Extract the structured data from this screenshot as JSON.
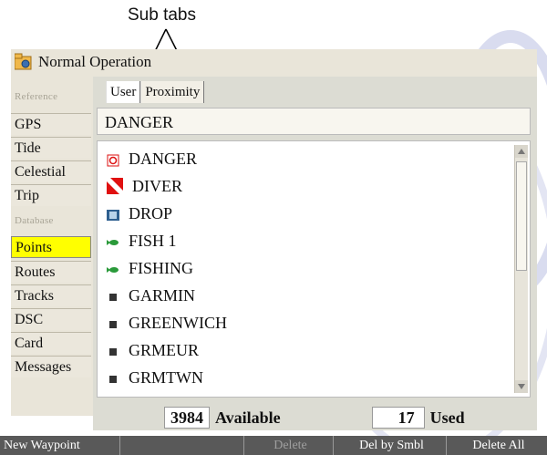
{
  "annotation": {
    "label": "Sub tabs"
  },
  "window": {
    "title": "Normal Operation",
    "icon": "folder-gear-icon"
  },
  "sidebar": {
    "section_reference": "Reference",
    "section_database": "Database",
    "items": [
      {
        "label": "GPS"
      },
      {
        "label": "Tide"
      },
      {
        "label": "Celestial"
      },
      {
        "label": "Trip"
      },
      {
        "label": "Points",
        "active": true
      },
      {
        "label": "Routes"
      },
      {
        "label": "Tracks"
      },
      {
        "label": "DSC"
      },
      {
        "label": "Card"
      },
      {
        "label": "Messages"
      }
    ]
  },
  "tabs": [
    {
      "label": "User",
      "active": true
    },
    {
      "label": "Proximity"
    }
  ],
  "selected_name": "DANGER",
  "waypoints": [
    {
      "name": "DANGER",
      "symbol": "danger-icon"
    },
    {
      "name": "DIVER",
      "symbol": "diver-flag-icon"
    },
    {
      "name": "DROP",
      "symbol": "drop-icon"
    },
    {
      "name": "FISH 1",
      "symbol": "fish-icon"
    },
    {
      "name": "FISHING",
      "symbol": "fish-icon"
    },
    {
      "name": "GARMIN",
      "symbol": "square-icon"
    },
    {
      "name": "GREENWICH",
      "symbol": "square-icon"
    },
    {
      "name": "GRMEUR",
      "symbol": "square-icon"
    },
    {
      "name": "GRMTWN",
      "symbol": "square-icon"
    }
  ],
  "counts": {
    "available_value": "3984",
    "available_label": "Available",
    "used_value": "17",
    "used_label": "Used"
  },
  "softkeys": [
    {
      "label": "New Waypoint",
      "enabled": true
    },
    {
      "label": "",
      "enabled": false
    },
    {
      "label": "Delete",
      "enabled": false
    },
    {
      "label": "Del by Smbl",
      "enabled": true
    },
    {
      "label": "Delete All",
      "enabled": true
    }
  ],
  "colors": {
    "active_item": "#ffff00",
    "softkey_bar": "#595959"
  }
}
